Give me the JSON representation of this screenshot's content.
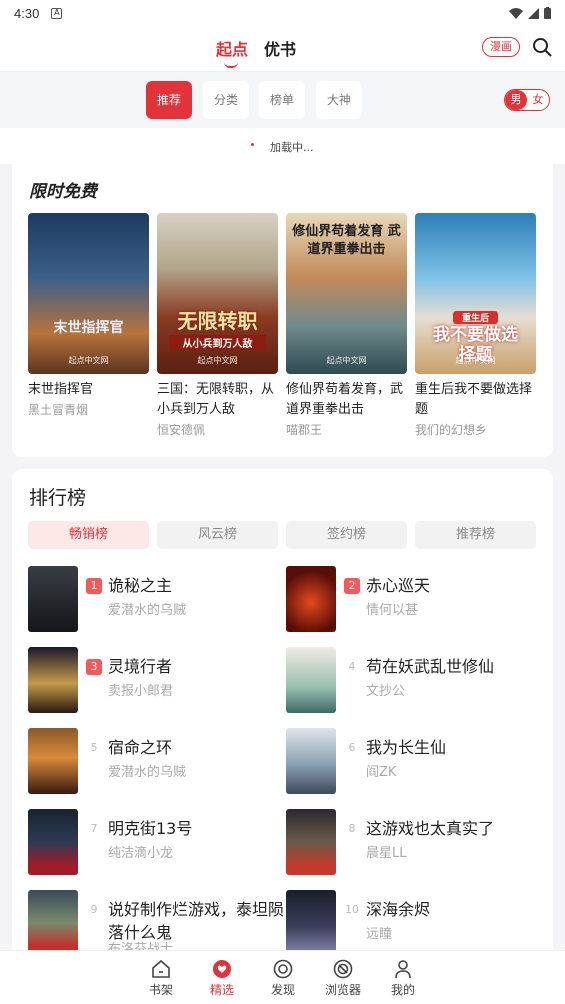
{
  "status": {
    "time": "4:30"
  },
  "header": {
    "tabs": [
      "起点",
      "优书"
    ],
    "comic_label": "漫画"
  },
  "categories": [
    "推荐",
    "分类",
    "榜单",
    "大神"
  ],
  "gender": {
    "male": "男",
    "female": "女"
  },
  "loading_text": "加载中...",
  "free_section": {
    "title": "限时免费",
    "books": [
      {
        "title": "末世指挥官",
        "author": "黑土冒青烟",
        "cover_text": "末世指挥官",
        "brand": "起点中文网"
      },
      {
        "title": "三国：无限转职，从小兵到万人敌",
        "author": "恒安德佩",
        "cover_text": "无限转职",
        "cover_sub": "从小兵到万人敌",
        "brand": "起点中文网"
      },
      {
        "title": "修仙界苟着发育，武道界重拳出击",
        "author": "喵郡王",
        "cover_text": "修仙界苟着发育 武道界重拳出击",
        "brand": "起点中文网"
      },
      {
        "title": "重生后我不要做选择题",
        "author": "我们的幻想乡",
        "cover_text": "我不要做选择题",
        "cover_sub": "重生后",
        "brand": "起点中文网"
      }
    ]
  },
  "rank_section": {
    "title": "排行榜",
    "tabs": [
      "畅销榜",
      "风云榜",
      "签约榜",
      "推荐榜"
    ],
    "items": [
      {
        "rank": "1",
        "title": "诡秘之主",
        "author": "爱潜水的乌贼"
      },
      {
        "rank": "2",
        "title": "赤心巡天",
        "author": "情何以甚"
      },
      {
        "rank": "3",
        "title": "灵境行者",
        "author": "卖报小郎君"
      },
      {
        "rank": "4",
        "title": "苟在妖武乱世修仙",
        "author": "文抄公"
      },
      {
        "rank": "5",
        "title": "宿命之环",
        "author": "爱潜水的乌贼"
      },
      {
        "rank": "6",
        "title": "我为长生仙",
        "author": "阎ZK"
      },
      {
        "rank": "7",
        "title": "明克街13号",
        "author": "纯洁滴小龙"
      },
      {
        "rank": "8",
        "title": "这游戏也太真实了",
        "author": "晨星LL"
      },
      {
        "rank": "9",
        "title": "说好制作烂游戏，泰坦陨落什么鬼",
        "author": "布洛芬战士"
      },
      {
        "rank": "10",
        "title": "深海余烬",
        "author": "远瞳"
      }
    ]
  },
  "bottom_nav": [
    "书架",
    "精选",
    "发现",
    "浏览器",
    "我的"
  ]
}
